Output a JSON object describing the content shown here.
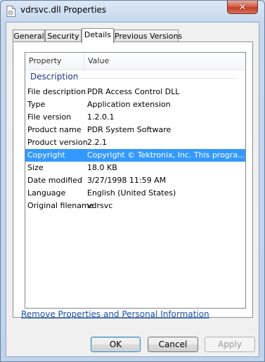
{
  "window": {
    "title": "vdrsvc.dll Properties",
    "close_label": "✕"
  },
  "tabs": [
    {
      "label": "General"
    },
    {
      "label": "Security"
    },
    {
      "label": "Details"
    },
    {
      "label": "Previous Versions"
    }
  ],
  "list": {
    "columns": {
      "property": "Property",
      "value": "Value"
    },
    "group": "Description",
    "rows": [
      {
        "property": "File description",
        "value": "PDR Access Control DLL"
      },
      {
        "property": "Type",
        "value": "Application extension"
      },
      {
        "property": "File version",
        "value": "1.2.0.1"
      },
      {
        "property": "Product name",
        "value": "PDR System Software"
      },
      {
        "property": "Product version",
        "value": "2.2.1"
      },
      {
        "property": "Copyright",
        "value": "Copyright © Tektronix, Inc.   This progra..."
      },
      {
        "property": "Size",
        "value": "18.0 KB"
      },
      {
        "property": "Date modified",
        "value": "3/27/1998 11:59 AM"
      },
      {
        "property": "Language",
        "value": "English (United States)"
      },
      {
        "property": "Original filename",
        "value": "vdrsvc"
      }
    ],
    "selected_row": "Copyright"
  },
  "remove_link": "Remove Properties and Personal Information",
  "buttons": {
    "ok": "OK",
    "cancel": "Cancel",
    "apply": "Apply"
  }
}
